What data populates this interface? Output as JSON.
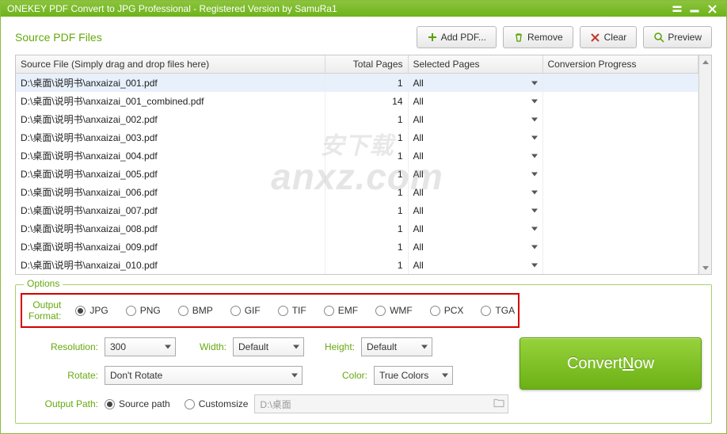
{
  "window": {
    "title": "ONEKEY PDF Convert to JPG Professional - Registered Version by SamuRa1"
  },
  "section": {
    "title": "Source PDF Files"
  },
  "toolbar": {
    "addPdf": "Add PDF...",
    "remove": "Remove",
    "clear": "Clear",
    "preview": "Preview"
  },
  "table": {
    "headers": {
      "sourceFile": "Source File (Simply drag and drop files here)",
      "totalPages": "Total Pages",
      "selectedPages": "Selected Pages",
      "conversionProgress": "Conversion Progress"
    },
    "rows": [
      {
        "file": "D:\\桌面\\说明书\\anxaizai_001.pdf",
        "pages": 1,
        "selected": "All"
      },
      {
        "file": "D:\\桌面\\说明书\\anxaizai_001_combined.pdf",
        "pages": 14,
        "selected": "All"
      },
      {
        "file": "D:\\桌面\\说明书\\anxaizai_002.pdf",
        "pages": 1,
        "selected": "All"
      },
      {
        "file": "D:\\桌面\\说明书\\anxaizai_003.pdf",
        "pages": 1,
        "selected": "All"
      },
      {
        "file": "D:\\桌面\\说明书\\anxaizai_004.pdf",
        "pages": 1,
        "selected": "All"
      },
      {
        "file": "D:\\桌面\\说明书\\anxaizai_005.pdf",
        "pages": 1,
        "selected": "All"
      },
      {
        "file": "D:\\桌面\\说明书\\anxaizai_006.pdf",
        "pages": 1,
        "selected": "All"
      },
      {
        "file": "D:\\桌面\\说明书\\anxaizai_007.pdf",
        "pages": 1,
        "selected": "All"
      },
      {
        "file": "D:\\桌面\\说明书\\anxaizai_008.pdf",
        "pages": 1,
        "selected": "All"
      },
      {
        "file": "D:\\桌面\\说明书\\anxaizai_009.pdf",
        "pages": 1,
        "selected": "All"
      },
      {
        "file": "D:\\桌面\\说明书\\anxaizai_010.pdf",
        "pages": 1,
        "selected": "All"
      }
    ]
  },
  "options": {
    "legend": "Options",
    "outputFormatLabel": "Output Format:",
    "formats": [
      "JPG",
      "PNG",
      "BMP",
      "GIF",
      "TIF",
      "EMF",
      "WMF",
      "PCX",
      "TGA"
    ],
    "selectedFormat": "JPG",
    "resolutionLabel": "Resolution:",
    "resolutionValue": "300",
    "widthLabel": "Width:",
    "widthValue": "Default",
    "heightLabel": "Height:",
    "heightValue": "Default",
    "rotateLabel": "Rotate:",
    "rotateValue": "Don't Rotate",
    "colorLabel": "Color:",
    "colorValue": "True Colors",
    "outputPathLabel": "Output Path:",
    "pathOptions": {
      "source": "Source path",
      "custom": "Customsize"
    },
    "selectedPathOption": "source",
    "pathValue": "D:\\桌面",
    "convert": {
      "pre": "Convert ",
      "hot": "N",
      "post": "ow"
    }
  },
  "watermark": {
    "top": "安下载",
    "bottom": "anxz.com"
  }
}
